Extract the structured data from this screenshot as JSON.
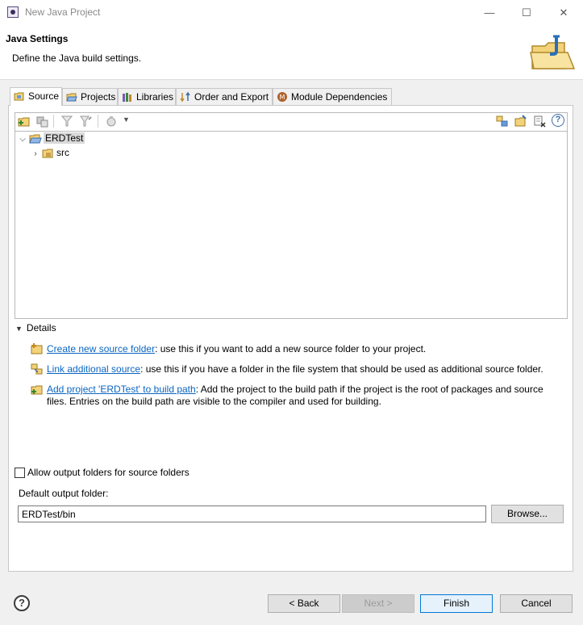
{
  "window": {
    "title": "New Java Project",
    "minimize": "—",
    "maximize": "☐",
    "close": "✕"
  },
  "header": {
    "title": "Java Settings",
    "description": "Define the Java build settings."
  },
  "tabs": [
    {
      "label": "Source",
      "icon": "source-folder-icon",
      "active": true
    },
    {
      "label": "Projects",
      "icon": "projects-icon",
      "active": false
    },
    {
      "label": "Libraries",
      "icon": "libraries-icon",
      "active": false
    },
    {
      "label": "Order and Export",
      "icon": "order-export-icon",
      "active": false
    },
    {
      "label": "Module Dependencies",
      "icon": "module-icon",
      "active": false
    }
  ],
  "tree": {
    "root": "ERDTest",
    "child": "src"
  },
  "details": {
    "title": "Details",
    "items": [
      {
        "link": "Create new source folder",
        "text": ": use this if you want to add a new source folder to your project."
      },
      {
        "link": "Link additional source",
        "text": ": use this if you have a folder in the file system that should be used as additional source folder."
      },
      {
        "link": "Add project 'ERDTest' to build path",
        "text": ": Add the project to the build path if the project is the root of packages and source",
        "text2": "files. Entries on the build path are visible to the compiler and used for building."
      }
    ]
  },
  "output": {
    "allow_label": "Allow output folders for source folders",
    "allow_checked": false,
    "default_label": "Default output folder:",
    "default_value": "ERDTest/bin",
    "browse_label": "Browse..."
  },
  "footer": {
    "help": "?",
    "back": "< Back",
    "next": "Next >",
    "finish": "Finish",
    "cancel": "Cancel"
  },
  "colors": {
    "link": "#0a65c2",
    "selection": "#d9d9d9",
    "primary_border": "#0078d7"
  }
}
